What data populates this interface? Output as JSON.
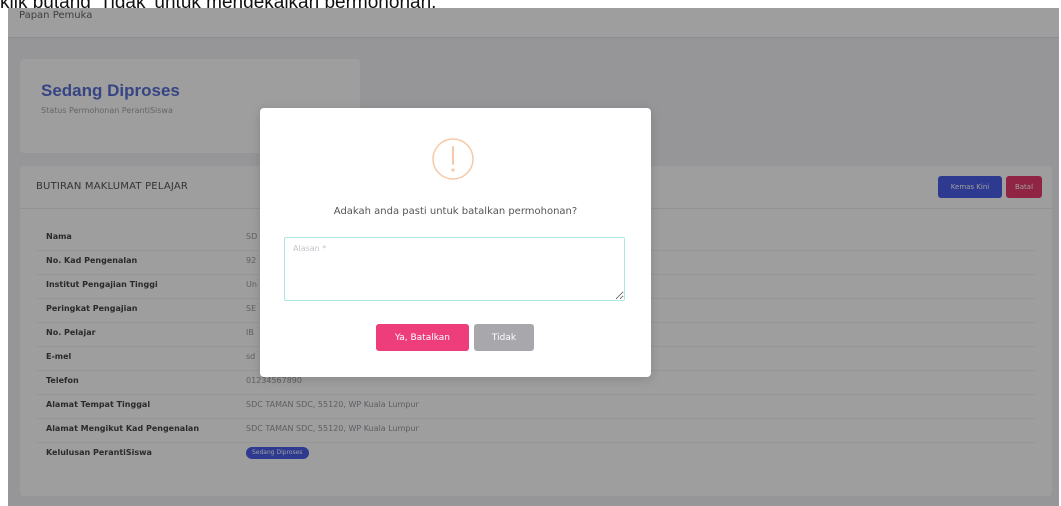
{
  "caption": "klik butang 'Tidak' untuk mengekalkan permohonan.",
  "breadcrumb": "Papan Pemuka",
  "status_card": {
    "title": "Sedang Diproses",
    "subtitle": "Status Permohonan PerantiSiswa"
  },
  "info_card": {
    "title": "BUTIRAN MAKLUMAT PELAJAR",
    "update_button": "Kemas Kini",
    "cancel_button": "Batal",
    "rows": [
      {
        "label": "Nama",
        "value": "SD"
      },
      {
        "label": "No. Kad Pengenalan",
        "value": "92"
      },
      {
        "label": "Institut Pengajian Tinggi",
        "value": "Un"
      },
      {
        "label": "Peringkat Pengajian",
        "value": "SE"
      },
      {
        "label": "No. Pelajar",
        "value": "IB"
      },
      {
        "label": "E-mel",
        "value": "sd"
      },
      {
        "label": "Telefon",
        "value": "01234567890"
      },
      {
        "label": "Alamat Tempat Tinggal",
        "value": "SDC TAMAN SDC, 55120, WP Kuala Lumpur"
      },
      {
        "label": "Alamat Mengikut Kad Pengenalan",
        "value": "SDC TAMAN SDC, 55120, WP Kuala Lumpur"
      },
      {
        "label": "Kelulusan PerantiSiswa",
        "value": "Sedang Diproses"
      }
    ]
  },
  "modal": {
    "icon": "warning-exclamation-icon",
    "question": "Adakah anda pasti untuk batalkan permohonan?",
    "textarea_placeholder": "Alasan *",
    "textarea_value": "",
    "confirm_button": "Ya, Batalkan",
    "reject_button": "Tidak"
  },
  "colors": {
    "accent": "#5a6fd6",
    "primary_button": "#4a5ee8",
    "danger": "#ee3d7b",
    "warning": "#f5c9a8",
    "muted_button": "#a8a8ac"
  }
}
